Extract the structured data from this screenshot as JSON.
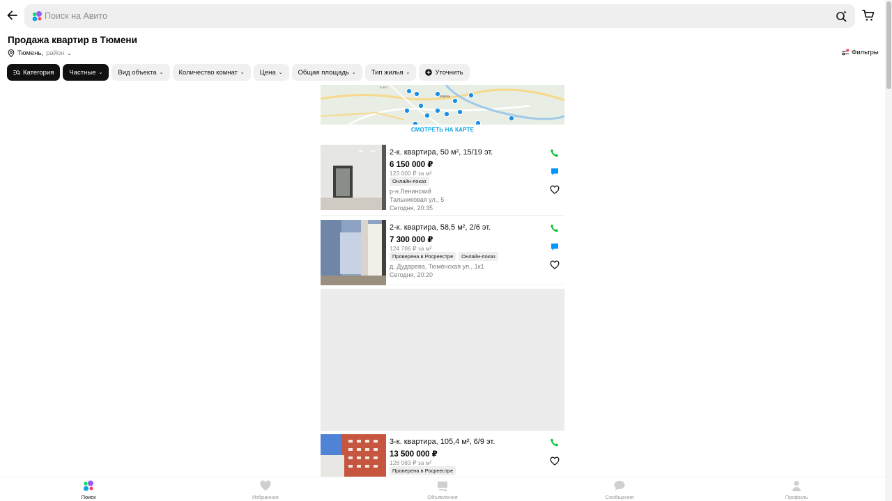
{
  "search": {
    "placeholder": "Поиск на Авито"
  },
  "page": {
    "title": "Продажа квартир в Тюмени",
    "city": "Тюмень,",
    "district": "район",
    "filters_label": "Фильтры"
  },
  "chips": [
    {
      "label": "Категория"
    },
    {
      "label": "Частные"
    },
    {
      "label": "Вид объекта"
    },
    {
      "label": "Количество комнат"
    },
    {
      "label": "Цена"
    },
    {
      "label": "Общая площадь"
    },
    {
      "label": "Тип жилья"
    },
    {
      "label": "Уточнить"
    }
  ],
  "map": {
    "link_label": "СМОТРЕТЬ НА КАРТЕ",
    "city_label": "Тюмень",
    "road_label": "Р-402"
  },
  "listings": [
    {
      "title": "2-к. квартира, 50 м², 15/19 эт.",
      "price": "6 150 000 ₽",
      "price_per_m2": "123 000 ₽ за м²",
      "badges": [
        "Онлайн-показ"
      ],
      "district": "р-н Ленинский",
      "address": "Тальниковая ул., 5",
      "date": "Сегодня, 20:35"
    },
    {
      "title": "2-к. квартира, 58,5 м², 2/6 эт.",
      "price": "7 300 000 ₽",
      "price_per_m2": "124 786 ₽ за м²",
      "badges": [
        "Проверена в Росреестре",
        "Онлайн-показ"
      ],
      "address": "д. Дударева, Тюменская ул., 1к1",
      "date": "Сегодня, 20:20"
    },
    {
      "title": "3-к. квартира, 105,4 м², 6/9 эт.",
      "price": "13 500 000 ₽",
      "price_per_m2": "128 083 ₽ за м²",
      "badges": [
        "Проверена в Росреестре"
      ]
    }
  ],
  "bottom_nav": [
    {
      "label": "Поиск",
      "icon": "search-logo-icon",
      "active": true
    },
    {
      "label": "Избранное",
      "icon": "heart-icon"
    },
    {
      "label": "Объявления",
      "icon": "ads-icon"
    },
    {
      "label": "Сообщения",
      "icon": "chat-icon"
    },
    {
      "label": "Профиль",
      "icon": "user-icon"
    }
  ],
  "colors": {
    "accent_blue": "#0aa6e6",
    "call_green": "#02c32d",
    "chat_blue": "#0096ff",
    "chip_dark": "#111111",
    "chip_light": "#f0f0f0"
  }
}
